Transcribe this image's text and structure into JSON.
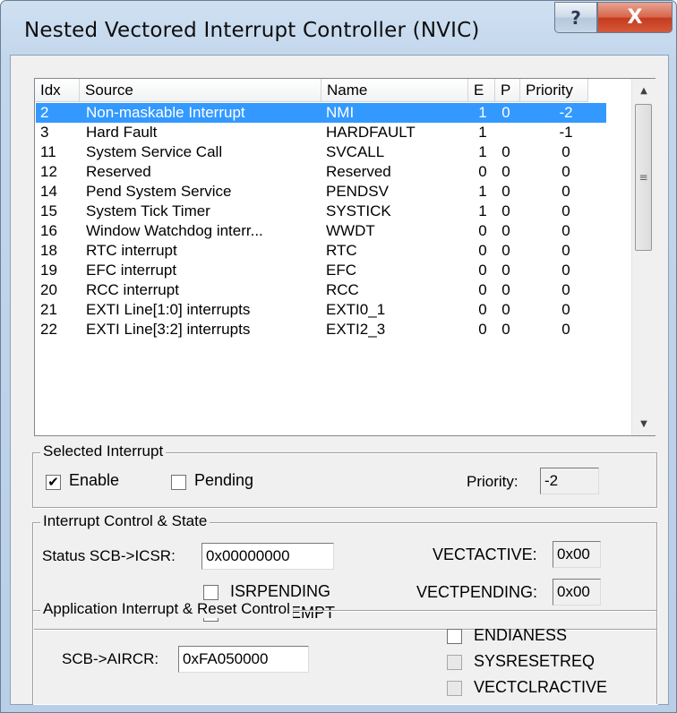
{
  "window": {
    "title": "Nested Vectored Interrupt Controller (NVIC)",
    "help_label": "?",
    "close_label": "X"
  },
  "table": {
    "columns": [
      "Idx",
      "Source",
      "Name",
      "E",
      "P",
      "Priority"
    ],
    "rows": [
      {
        "idx": "2",
        "source": "Non-maskable Interrupt",
        "name": "NMI",
        "e": "1",
        "p": "0",
        "priority": "-2"
      },
      {
        "idx": "3",
        "source": "Hard Fault",
        "name": "HARDFAULT",
        "e": "1",
        "p": "",
        "priority": "-1"
      },
      {
        "idx": "11",
        "source": "System Service Call",
        "name": "SVCALL",
        "e": "1",
        "p": "0",
        "priority": "0"
      },
      {
        "idx": "12",
        "source": "Reserved",
        "name": "Reserved",
        "e": "0",
        "p": "0",
        "priority": "0"
      },
      {
        "idx": "14",
        "source": "Pend System Service",
        "name": "PENDSV",
        "e": "1",
        "p": "0",
        "priority": "0"
      },
      {
        "idx": "15",
        "source": "System Tick Timer",
        "name": "SYSTICK",
        "e": "1",
        "p": "0",
        "priority": "0"
      },
      {
        "idx": "16",
        "source": "Window Watchdog interr...",
        "name": "WWDT",
        "e": "0",
        "p": "0",
        "priority": "0"
      },
      {
        "idx": "18",
        "source": "RTC interrupt",
        "name": "RTC",
        "e": "0",
        "p": "0",
        "priority": "0"
      },
      {
        "idx": "19",
        "source": "EFC interrupt",
        "name": "EFC",
        "e": "0",
        "p": "0",
        "priority": "0"
      },
      {
        "idx": "20",
        "source": "RCC interrupt",
        "name": "RCC",
        "e": "0",
        "p": "0",
        "priority": "0"
      },
      {
        "idx": "21",
        "source": "EXTI Line[1:0] interrupts",
        "name": "EXTI0_1",
        "e": "0",
        "p": "0",
        "priority": "0"
      },
      {
        "idx": "22",
        "source": "EXTI Line[3:2] interrupts",
        "name": "EXTI2_3",
        "e": "0",
        "p": "0",
        "priority": "0"
      }
    ],
    "selected_row_index": 0,
    "scroll_up_glyph": "▲",
    "scroll_down_glyph": "▼",
    "scroll_grip_glyph": "≡"
  },
  "selected_interrupt": {
    "legend": "Selected Interrupt",
    "enable_label": "Enable",
    "enable_checked": true,
    "enable_check_glyph": "✔",
    "pending_label": "Pending",
    "pending_checked": false,
    "priority_label": "Priority:",
    "priority_value": "-2"
  },
  "interrupt_control": {
    "legend": "Interrupt Control & State",
    "status_label": "Status  SCB->ICSR:",
    "icsr_value": "0x00000000",
    "vectactive_label": "VECTACTIVE:",
    "vectactive_value": "0x00",
    "vectpending_label": "VECTPENDING:",
    "vectpending_value": "0x00",
    "isrpending_label": "ISRPENDING",
    "isrpreempt_label": "ISRPREEMPT"
  },
  "app_reset": {
    "legend": "Application Interrupt & Reset Control",
    "aircr_label": "SCB->AIRCR:",
    "aircr_value": "0xFA050000",
    "endianess_label": "ENDIANESS",
    "sysresetreq_label": "SYSRESETREQ",
    "vectclractive_label": "VECTCLRACTIVE"
  },
  "colors": {
    "selection": "#3399ff",
    "close_button": "#c53a1c",
    "dialog_face": "#f0f0f0"
  }
}
